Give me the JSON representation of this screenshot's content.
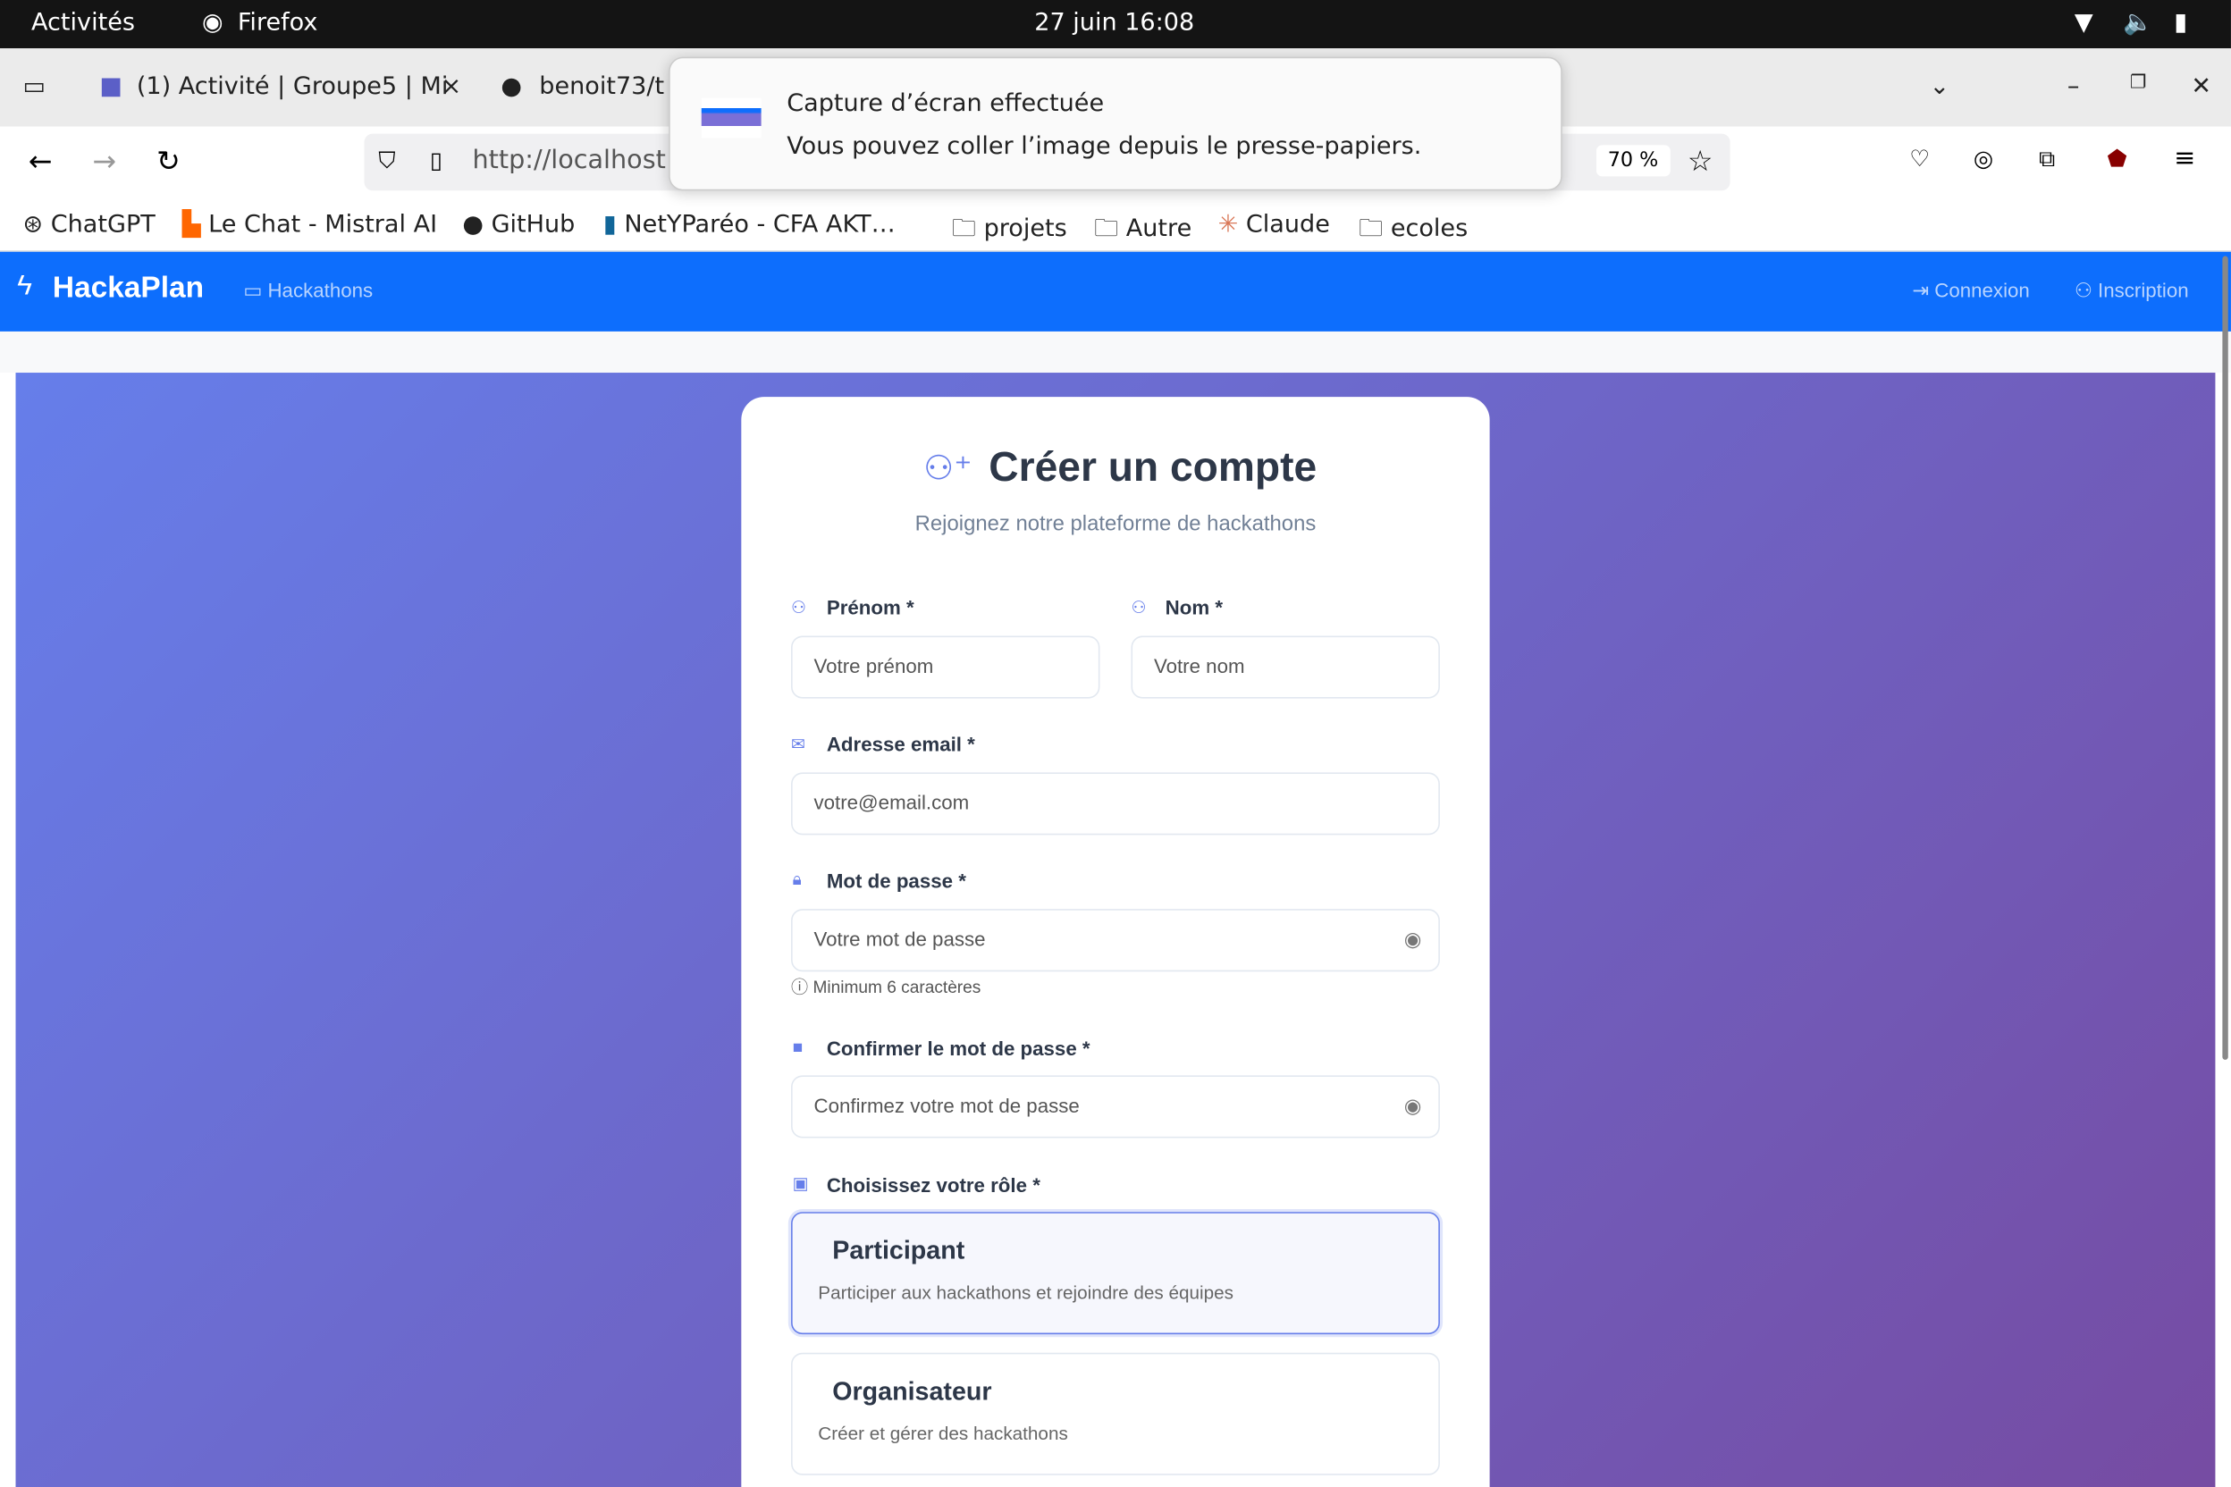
{
  "system": {
    "activities": "Activités",
    "app": "Firefox",
    "datetime": "27 juin  16:08"
  },
  "browser": {
    "tabs": [
      {
        "label": "(1) Activité | Groupe5 | Mi"
      },
      {
        "label": "benoit73/t"
      }
    ],
    "url": "http://localhost",
    "zoom": "70 %"
  },
  "bookmarks": [
    "ChatGPT",
    "Le Chat - Mistral AI",
    "GitHub",
    "NetYParéo - CFA AKT…",
    "projets",
    "Autre",
    "Claude",
    "ecoles"
  ],
  "toast": {
    "title": "Capture d’écran effectuée",
    "body": "Vous pouvez coller l’image depuis le presse-papiers."
  },
  "app": {
    "brand": "HackaPlan",
    "nav": {
      "hackathons": "Hackathons",
      "login": "Connexion",
      "register": "Inscription"
    }
  },
  "form": {
    "title": "Créer un compte",
    "subtitle": "Rejoignez notre plateforme de hackathons",
    "first_name": {
      "label": "Prénom *",
      "placeholder": "Votre prénom"
    },
    "last_name": {
      "label": "Nom *",
      "placeholder": "Votre nom"
    },
    "email": {
      "label": "Adresse email *",
      "placeholder": "votre@email.com"
    },
    "password": {
      "label": "Mot de passe *",
      "placeholder": "Votre mot de passe",
      "hint": "Minimum 6 caractères"
    },
    "confirm": {
      "label": "Confirmer le mot de passe *",
      "placeholder": "Confirmez votre mot de passe"
    },
    "role": {
      "label": "Choisissez votre rôle *",
      "options": [
        {
          "name": "Participant",
          "desc": "Participer aux hackathons et rejoindre des équipes",
          "selected": true
        },
        {
          "name": "Organisateur",
          "desc": "Créer et gérer des hackathons",
          "selected": false
        }
      ]
    }
  },
  "colors": {
    "accent": "#0d6efd",
    "gradient_start": "#667eea",
    "gradient_end": "#764ba2"
  }
}
